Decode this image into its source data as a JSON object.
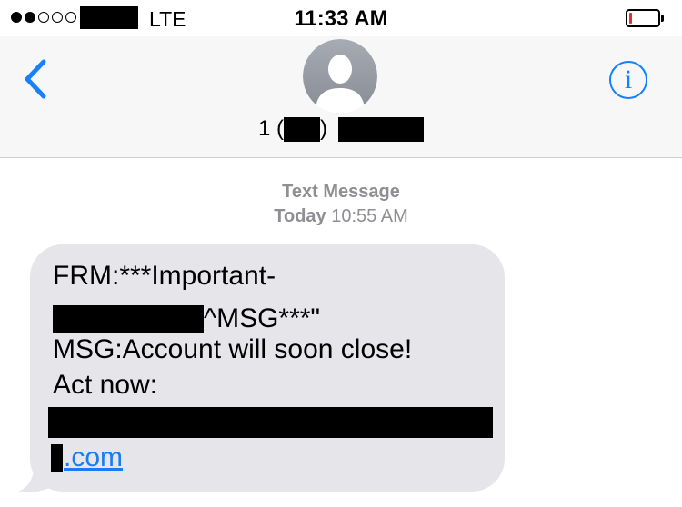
{
  "status_bar": {
    "signal_bars_filled": 2,
    "signal_bars_total": 5,
    "network": "LTE",
    "time": "11:33 AM",
    "battery_level": 0.08,
    "battery_color": "#e5302a"
  },
  "header": {
    "back_icon": "chevron-left-icon",
    "info_icon": "info-icon",
    "info_glyph": "i",
    "avatar_icon": "person-silhouette-icon",
    "contact_prefix": "1 (",
    "contact_mid": ")",
    "accent_color": "#1780fb"
  },
  "conversation": {
    "message_type": "Text Message",
    "day": "Today",
    "time": "10:55 AM",
    "message": {
      "line1": "FRM:***Important-",
      "line2_suffix": "^MSG***\"",
      "line3": "MSG:Account will soon close!",
      "line4": "Act now:",
      "link_suffix": ".com",
      "bubble_color": "#e5e5ea",
      "link_color": "#1a7cf5"
    }
  }
}
